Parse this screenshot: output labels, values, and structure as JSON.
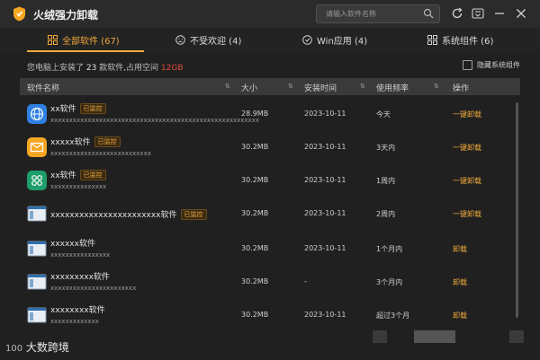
{
  "window": {
    "title": "火绒强力卸载"
  },
  "search": {
    "placeholder": "请输入软件名称"
  },
  "tabs": [
    {
      "label": "全部软件 (67)",
      "icon": "grid-icon",
      "active": true
    },
    {
      "label": "不受欢迎 (4)",
      "icon": "frown-icon",
      "active": false
    },
    {
      "label": "Win应用 (4)",
      "icon": "windows-icon",
      "active": false
    },
    {
      "label": "系统组件 (6)",
      "icon": "puzzle-icon",
      "active": false
    }
  ],
  "summary": {
    "prefix": "您电脑上安装了 ",
    "count": "23",
    "mid": " 款软件,占用空间 ",
    "size": "12GB"
  },
  "hide_system": {
    "label": "隐藏系统组件",
    "checked": false
  },
  "table": {
    "headers": {
      "name": "软件名称",
      "size": "大小",
      "date": "安装时间",
      "freq": "使用频率",
      "action": "操作"
    },
    "rows": [
      {
        "name": "xx软件",
        "badge": "已监控",
        "desc": "xxxxxxxxxxxxxxxxxxxxxxxxxxxxxxxxxxxxxxxxxxxxxxxxxxxxxxxx",
        "size": "28.9MB",
        "date": "2023-10-11",
        "freq": "今天",
        "action": "一键卸载",
        "icon": "globe-icon",
        "color": "#2f7fe0"
      },
      {
        "name": "xxxxx软件",
        "badge": "已监控",
        "desc": "xxxxxxxxxxxxxxxxxxxxxxxxxxx",
        "size": "30.2MB",
        "date": "2023-10-11",
        "freq": "3天内",
        "action": "一键卸载",
        "icon": "mail-icon",
        "color": "#f5a623"
      },
      {
        "name": "xx软件",
        "badge": "已监控",
        "desc": "xxxxxxxxxxxxxxx",
        "size": "30.2MB",
        "date": "2023-10-11",
        "freq": "1周内",
        "action": "一键卸载",
        "icon": "command-icon",
        "color": "#1e9e6a"
      },
      {
        "name": "xxxxxxxxxxxxxxxxxxxxxxx软件",
        "badge": "已监控",
        "desc": "",
        "size": "30.2MB",
        "date": "2023-10-11",
        "freq": "2周内",
        "action": "一键卸载",
        "icon": "window-icon",
        "color": "#5a6b7b"
      },
      {
        "name": "xxxxxx软件",
        "badge": "",
        "desc": "xxxxxxxxxxxxxxxx",
        "size": "30.2MB",
        "date": "2023-10-11",
        "freq": "1个月内",
        "action": "卸载",
        "icon": "window-icon",
        "color": "#5a6b7b"
      },
      {
        "name": "xxxxxxxxx软件",
        "badge": "",
        "desc": "xxxxxxxxxxxxxxxxxxxxxxx",
        "size": "30.2MB",
        "date": "-",
        "freq": "3个月内",
        "action": "卸载",
        "icon": "window-icon",
        "color": "#5a6b7b"
      },
      {
        "name": "xxxxxxxx软件",
        "badge": "",
        "desc": "xxxxxxxxxxxxx",
        "size": "30.2MB",
        "date": "2023-10-11",
        "freq": "超过3个月",
        "action": "卸载",
        "icon": "window-icon",
        "color": "#5a6b7b"
      }
    ]
  },
  "footer": {
    "watermark_number": "100",
    "watermark_text": "大数跨境"
  },
  "colors": {
    "accent": "#f0a93b",
    "danger": "#e24a3b",
    "background": "#202020"
  }
}
